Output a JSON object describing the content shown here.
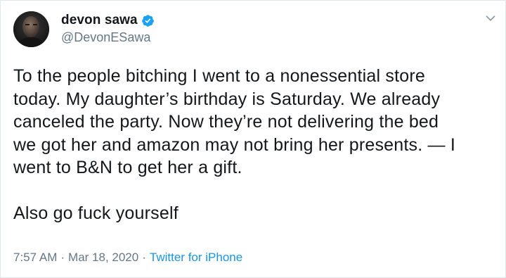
{
  "author": {
    "display_name": "devon sawa",
    "handle": "@DevonESawa",
    "verified": true,
    "verified_color": "#1da1f2"
  },
  "tweet": {
    "lines": [
      "To the people bitching I went to a nonessential store",
      "today. My daughter’s birthday is Saturday. We already",
      "canceled the party. Now they’re not delivering the bed",
      "we got her and amazon may not bring her presents. — I",
      "went to B&N to get her a gift.",
      "Also go fuck yourself"
    ]
  },
  "meta": {
    "time": "7:57 AM",
    "separator": "·",
    "date": "Mar 18, 2020",
    "source": "Twitter for iPhone",
    "source_color": "#1b95e0"
  },
  "icons": {
    "menu": "chevron-down-icon",
    "verified": "verified-badge-icon"
  }
}
